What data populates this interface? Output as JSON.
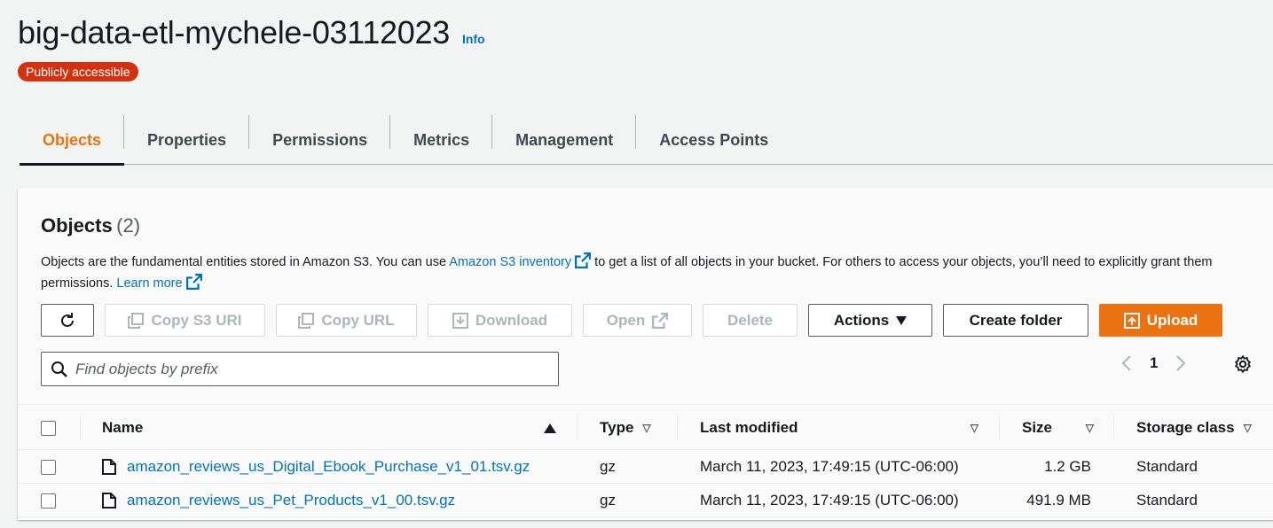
{
  "header": {
    "bucket_name": "big-data-etl-mychele-03112023",
    "info_label": "Info",
    "badge": "Publicly accessible"
  },
  "tabs": [
    {
      "label": "Objects",
      "active": true
    },
    {
      "label": "Properties"
    },
    {
      "label": "Permissions"
    },
    {
      "label": "Metrics"
    },
    {
      "label": "Management"
    },
    {
      "label": "Access Points"
    }
  ],
  "objects_panel": {
    "title": "Objects",
    "count": "(2)",
    "desc_part1": "Objects are the fundamental entities stored in Amazon S3. You can use ",
    "desc_link1": "Amazon S3 inventory",
    "desc_part2": " to get a list of all objects in your bucket. For others to access your objects, you’ll need to explicitly grant them permissions. ",
    "desc_link2": "Learn more"
  },
  "toolbar": {
    "refresh_icon": "refresh-icon",
    "copy_s3_uri": "Copy S3 URI",
    "copy_url": "Copy URL",
    "download": "Download",
    "open": "Open",
    "delete": "Delete",
    "actions": "Actions",
    "create_folder": "Create folder",
    "upload": "Upload"
  },
  "search": {
    "placeholder": "Find objects by prefix"
  },
  "pagination": {
    "current_page": "1"
  },
  "table": {
    "columns": {
      "name": "Name",
      "type": "Type",
      "last_modified": "Last modified",
      "size": "Size",
      "storage_class": "Storage class"
    },
    "rows": [
      {
        "name": "amazon_reviews_us_Digital_Ebook_Purchase_v1_01.tsv.gz",
        "type": "gz",
        "last_modified": "March 11, 2023, 17:49:15 (UTC-06:00)",
        "size": "1.2 GB",
        "storage_class": "Standard"
      },
      {
        "name": "amazon_reviews_us_Pet_Products_v1_00.tsv.gz",
        "type": "gz",
        "last_modified": "March 11, 2023, 17:49:15 (UTC-06:00)",
        "size": "491.9 MB",
        "storage_class": "Standard"
      }
    ]
  },
  "colors": {
    "accent": "#ec7211",
    "link": "#0073bb",
    "badge": "#d13212"
  }
}
